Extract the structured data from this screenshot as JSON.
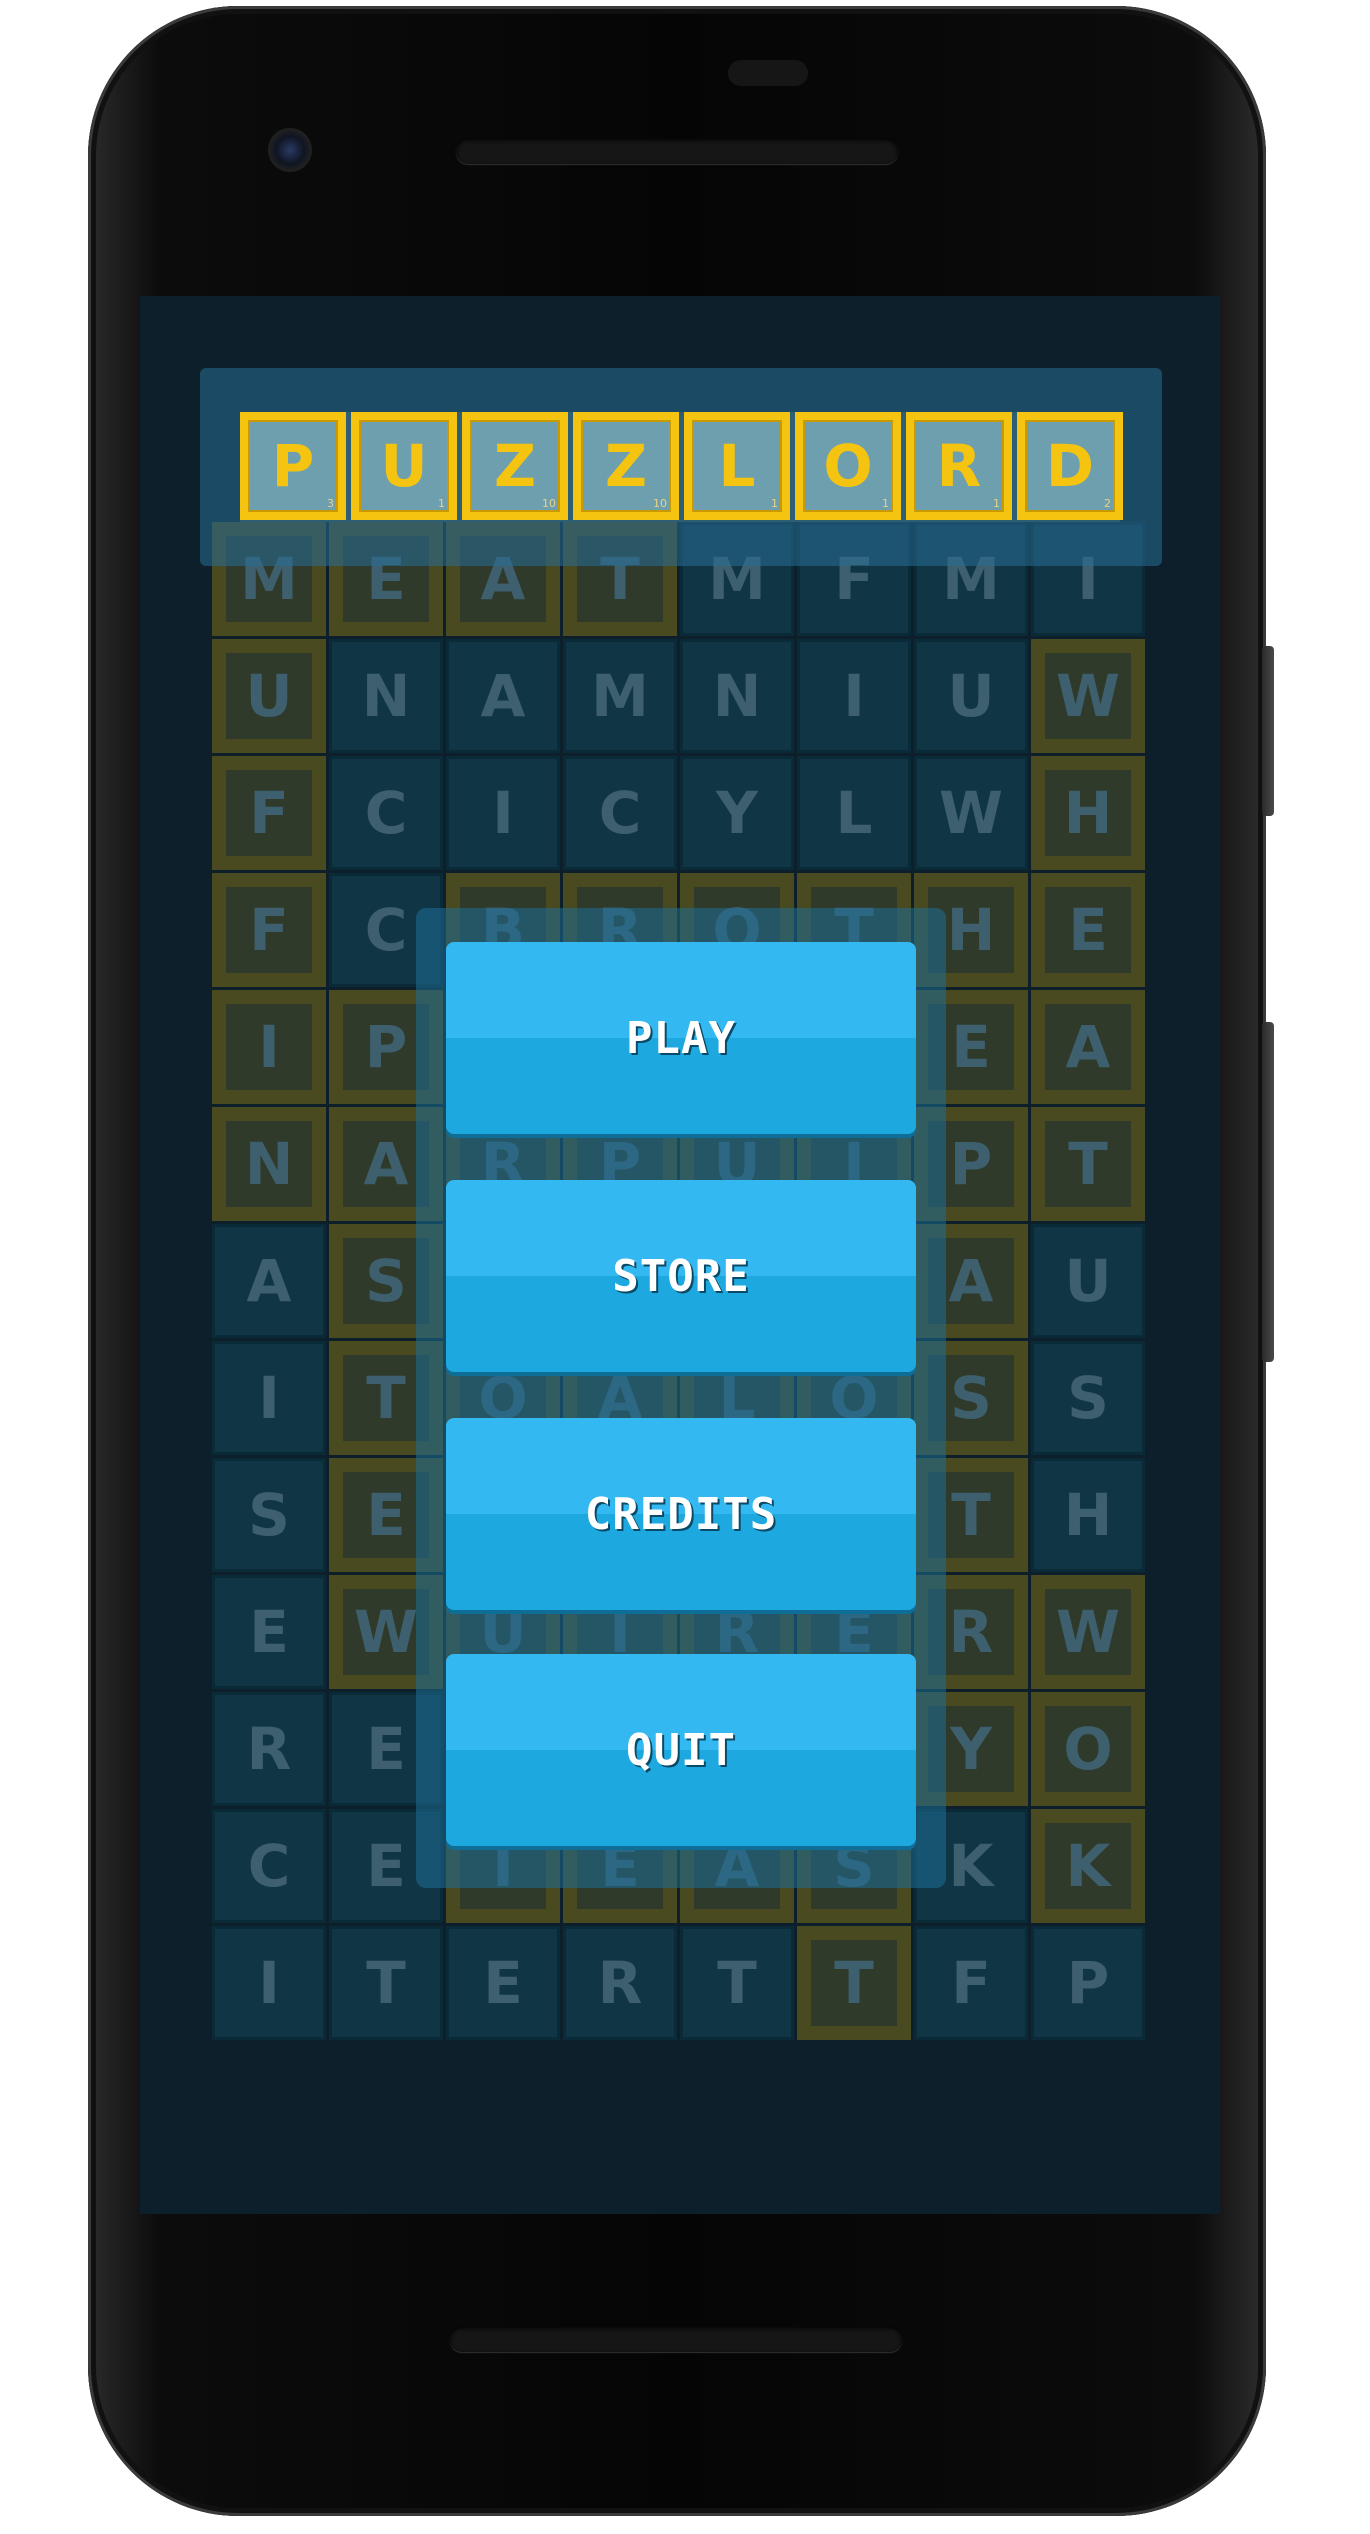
{
  "app": {
    "title_letters": [
      {
        "letter": "P",
        "score": "3"
      },
      {
        "letter": "U",
        "score": "1"
      },
      {
        "letter": "Z",
        "score": "10"
      },
      {
        "letter": "Z",
        "score": "10"
      },
      {
        "letter": "L",
        "score": "1"
      },
      {
        "letter": "O",
        "score": "1"
      },
      {
        "letter": "R",
        "score": "1"
      },
      {
        "letter": "D",
        "score": "2"
      }
    ]
  },
  "menu": {
    "play_label": "PLAY",
    "store_label": "STORE",
    "credits_label": "CREDITS",
    "quit_label": "QUIT"
  },
  "board": {
    "rows": [
      [
        "M",
        "E",
        "A",
        "T",
        "M",
        "F",
        "M",
        "I"
      ],
      [
        "U",
        "N",
        "A",
        "M",
        "N",
        "I",
        "U",
        "W"
      ],
      [
        "F",
        "C",
        "I",
        "C",
        "Y",
        "L",
        "W",
        "H"
      ],
      [
        "F",
        "C",
        "B",
        "R",
        "O",
        "T",
        "H",
        "E"
      ],
      [
        "I",
        "P",
        "",
        "",
        "",
        "",
        "E",
        "A"
      ],
      [
        "N",
        "A",
        "R",
        "P",
        "U",
        "I",
        "P",
        "T"
      ],
      [
        "A",
        "S",
        "",
        "",
        "",
        "",
        "A",
        "U"
      ],
      [
        "I",
        "T",
        "O",
        "A",
        "L",
        "O",
        "S",
        "S"
      ],
      [
        "S",
        "E",
        "",
        "",
        "",
        "",
        "T",
        "H"
      ],
      [
        "E",
        "W",
        "U",
        "I",
        "R",
        "E",
        "R",
        "W"
      ],
      [
        "R",
        "E",
        "",
        "",
        "",
        "",
        "Y",
        "O"
      ],
      [
        "C",
        "E",
        "I",
        "E",
        "A",
        "S",
        "K",
        "K"
      ],
      [
        "I",
        "T",
        "E",
        "R",
        "T",
        "T",
        "F",
        "P"
      ]
    ],
    "highlighted": [
      [
        1,
        1,
        1,
        1,
        0,
        0,
        0,
        0
      ],
      [
        1,
        0,
        0,
        0,
        0,
        0,
        0,
        1
      ],
      [
        1,
        0,
        0,
        0,
        0,
        0,
        0,
        1
      ],
      [
        1,
        0,
        1,
        1,
        1,
        1,
        1,
        1
      ],
      [
        1,
        1,
        0,
        0,
        0,
        0,
        1,
        1
      ],
      [
        1,
        1,
        1,
        1,
        1,
        1,
        1,
        1
      ],
      [
        0,
        1,
        0,
        0,
        0,
        0,
        1,
        0
      ],
      [
        0,
        1,
        1,
        1,
        1,
        1,
        1,
        0
      ],
      [
        0,
        1,
        0,
        0,
        0,
        0,
        1,
        0
      ],
      [
        0,
        1,
        1,
        1,
        1,
        1,
        1,
        1
      ],
      [
        0,
        0,
        0,
        0,
        0,
        0,
        1,
        1
      ],
      [
        0,
        0,
        1,
        1,
        1,
        1,
        0,
        1
      ],
      [
        0,
        0,
        0,
        0,
        0,
        1,
        0,
        0
      ]
    ]
  },
  "colors": {
    "accent": "#34b8f2",
    "tile_border": "#f5c411",
    "screen_bg": "#0d1f2b"
  }
}
